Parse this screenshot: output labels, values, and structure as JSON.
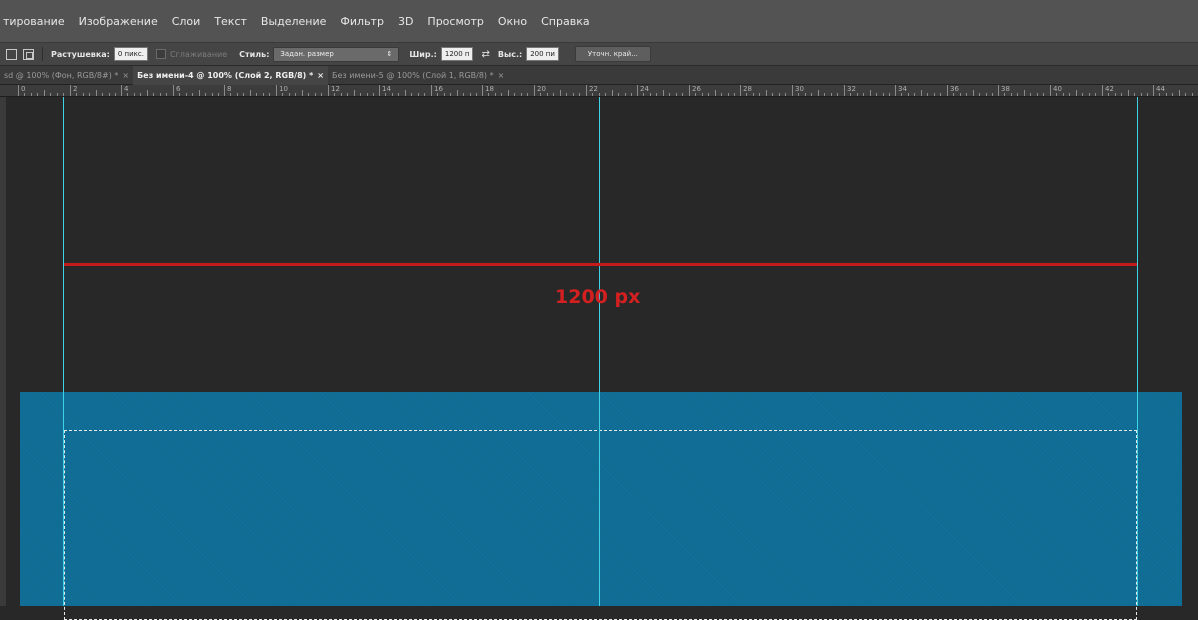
{
  "menu": [
    "тирование",
    "Изображение",
    "Слои",
    "Текст",
    "Выделение",
    "Фильтр",
    "3D",
    "Просмотр",
    "Окно",
    "Справка"
  ],
  "options": {
    "feather_label": "Растушевка:",
    "feather_value": "0 пикс.",
    "antialias_label": "Сглаживание",
    "style_label": "Стиль:",
    "style_value": "Задан. размер",
    "width_label": "Шир.:",
    "width_value": "1200 п",
    "height_label": "Выс.:",
    "height_value": "200 пи",
    "refine_button": "Уточн. край..."
  },
  "tabs": [
    {
      "label": "sd @ 100% (Фон, RGB/8#) *",
      "active": false
    },
    {
      "label": "Без имени-4 @ 100% (Слой 2, RGB/8) *",
      "active": true
    },
    {
      "label": "Без имени-5 @ 100% (Слой 1, RGB/8) *",
      "active": false
    }
  ],
  "ruler_labels": [
    "0",
    "2",
    "4",
    "6",
    "8",
    "10",
    "12",
    "14",
    "16",
    "18",
    "20",
    "22",
    "24",
    "26",
    "28",
    "30",
    "32",
    "34",
    "36",
    "38",
    "40",
    "42",
    "44",
    "46"
  ],
  "canvas": {
    "dimension_label": "1200 px",
    "colors": {
      "background": "#282828",
      "layer": "#0f6c94",
      "guide": "#3dd2e6",
      "measure": "#c41c1c"
    }
  }
}
